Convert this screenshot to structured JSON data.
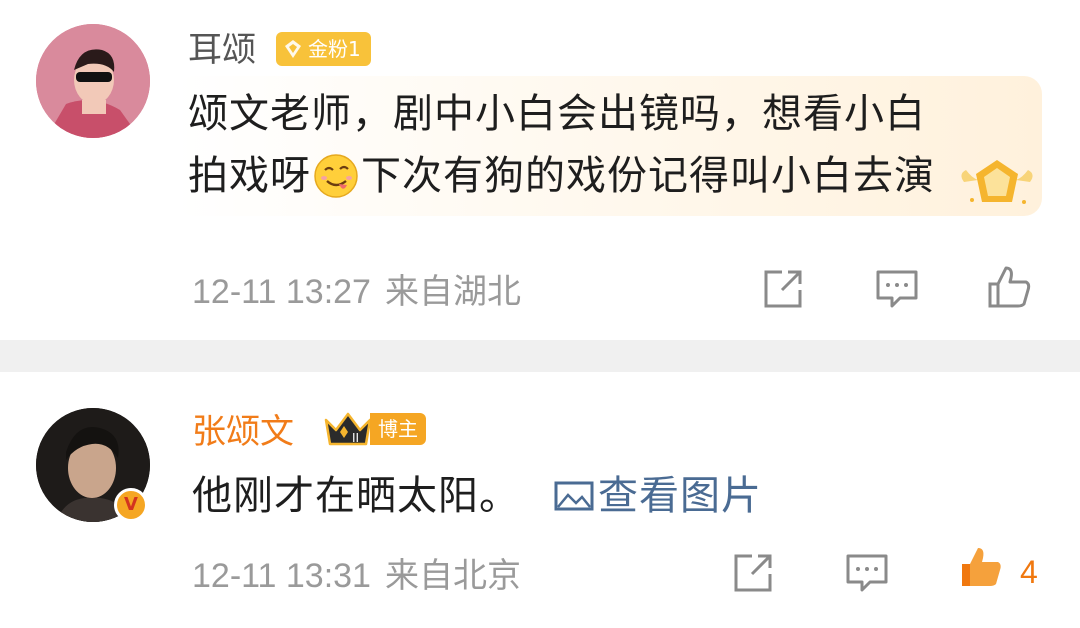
{
  "comments": [
    {
      "username": "耳颂",
      "badge": "金粉1",
      "text_line1": "颂文老师，剧中小白会出镜吗，想看小白",
      "text_line2_before_emoji": "拍戏呀",
      "text_line2_after_emoji": "下次有狗的戏份记得叫小白去演",
      "emoji_icon": "drooling-face-emoji",
      "time": "12-11 13:27",
      "location": "来自湖北",
      "actions": [
        "share-icon",
        "comment-icon",
        "like-icon"
      ]
    },
    {
      "username": "张颂文",
      "badge": "博主",
      "verified": "V",
      "text": "他刚才在晒太阳。",
      "view_image_label": "查看图片",
      "time": "12-11 13:31",
      "location": "来自北京",
      "like_count": "4",
      "actions": [
        "share-icon",
        "comment-icon",
        "like-icon"
      ]
    }
  ],
  "colors": {
    "accent_orange": "#f17c19",
    "link_blue": "#4a6b93",
    "meta_gray": "#9a9a9a",
    "divider": "#f0f0f0",
    "fan_badge": "#f8c23a"
  }
}
